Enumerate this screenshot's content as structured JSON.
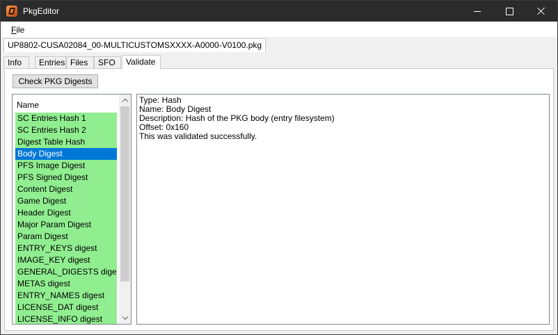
{
  "window": {
    "title": "PkgEditor"
  },
  "menu": {
    "file_hotkey": "F",
    "file_rest": "ile"
  },
  "document_tab": "UP8802-CUSA02084_00-MULTICUSTOMSXXXX-A0000-V0100.pkg",
  "tabs": [
    "Info",
    "Entries",
    "Files",
    "SFO",
    "Validate"
  ],
  "active_tab": "Validate",
  "validate": {
    "check_button": "Check PKG Digests",
    "list_header": "Name",
    "selected": "Body Digest",
    "items": [
      "SC Entries Hash 1",
      "SC Entries Hash 2",
      "Digest Table Hash",
      "Body Digest",
      "PFS Image Digest",
      "PFS Signed Digest",
      "Content Digest",
      "Game Digest",
      "Header Digest",
      "Major Param Digest",
      "Param Digest",
      "ENTRY_KEYS digest",
      "IMAGE_KEY digest",
      "GENERAL_DIGESTS digest",
      "METAS digest",
      "ENTRY_NAMES digest",
      "LICENSE_DAT digest",
      "LICENSE_INFO digest"
    ],
    "details": [
      "Type: Hash",
      "Name: Body Digest",
      "Description: Hash of the PKG body (entry filesystem)",
      "Offset: 0x160",
      "This was validated successfully."
    ]
  },
  "colors": {
    "valid_item": "#90ee90",
    "selected_item": "#0078d7",
    "titlebar": "#2b2b2b"
  },
  "icons": [
    "app-icon",
    "minimize-icon",
    "maximize-icon",
    "close-icon",
    "scroll-up-icon",
    "scroll-down-icon"
  ]
}
